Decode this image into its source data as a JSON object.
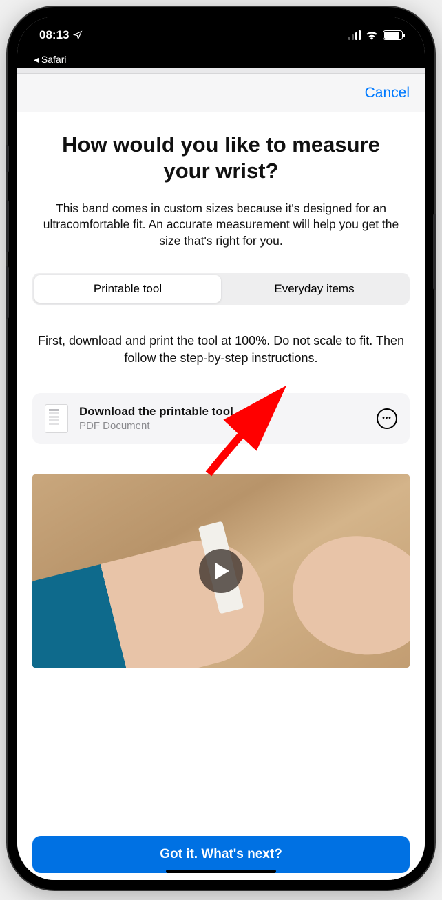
{
  "status": {
    "time": "08:13",
    "back_app": "Safari"
  },
  "nav": {
    "cancel": "Cancel"
  },
  "page": {
    "title": "How would you like to measure your wrist?",
    "subtitle": "This band comes in custom sizes because it's designed for an ultracomfortable fit. An accurate measurement will help you get the size that's right for you.",
    "instructions": "First, download and print the tool at 100%. Do not scale to fit. Then follow the step-by-step instructions."
  },
  "segments": {
    "printable": "Printable tool",
    "everyday": "Everyday items",
    "active": "printable"
  },
  "download": {
    "title": "Download the printable tool",
    "subtitle": "PDF Document"
  },
  "cta": {
    "label": "Got it. What's next?"
  }
}
